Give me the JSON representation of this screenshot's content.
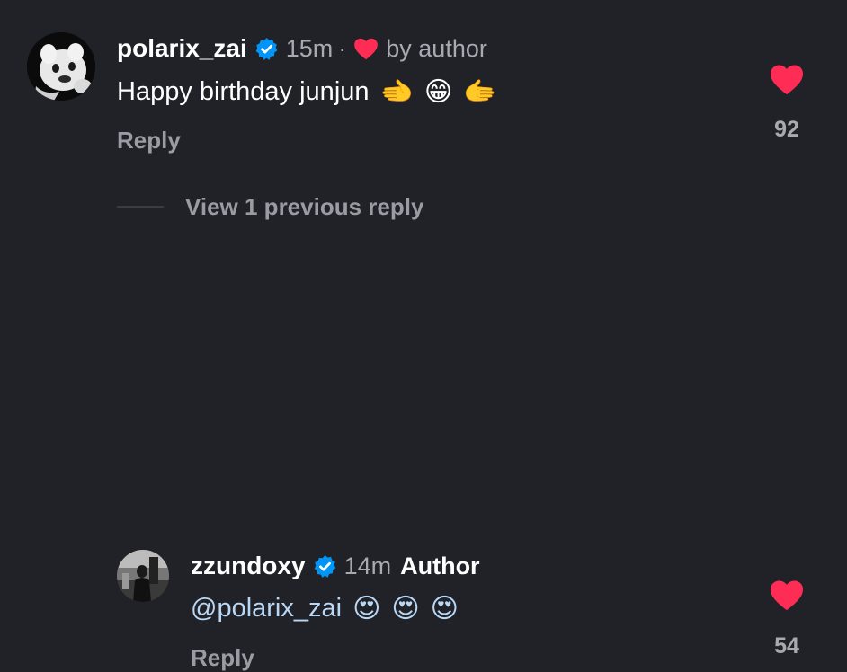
{
  "comments": [
    {
      "username": "polarix_zai",
      "time": "15m",
      "separator": "·",
      "liked_by": "by author",
      "text": "Happy birthday junjun",
      "emojis": [
        "🫲",
        "😁",
        "🫱"
      ],
      "reply_label": "Reply",
      "like_count": "92"
    },
    {
      "username": "zzundoxy",
      "time": "14m",
      "author_tag": "Author",
      "text": "@polarix_zai",
      "emojis": [
        "😍",
        "😍",
        "😍"
      ],
      "reply_label": "Reply",
      "like_count": "54"
    }
  ],
  "view_replies": "View 1 previous reply",
  "icons": {
    "verified": "verified-badge-icon",
    "heart": "heart-icon"
  },
  "colors": {
    "background": "#212228",
    "heart": "#ff2d55",
    "verified": "#0095f6",
    "mention": "#b9d8f5"
  }
}
